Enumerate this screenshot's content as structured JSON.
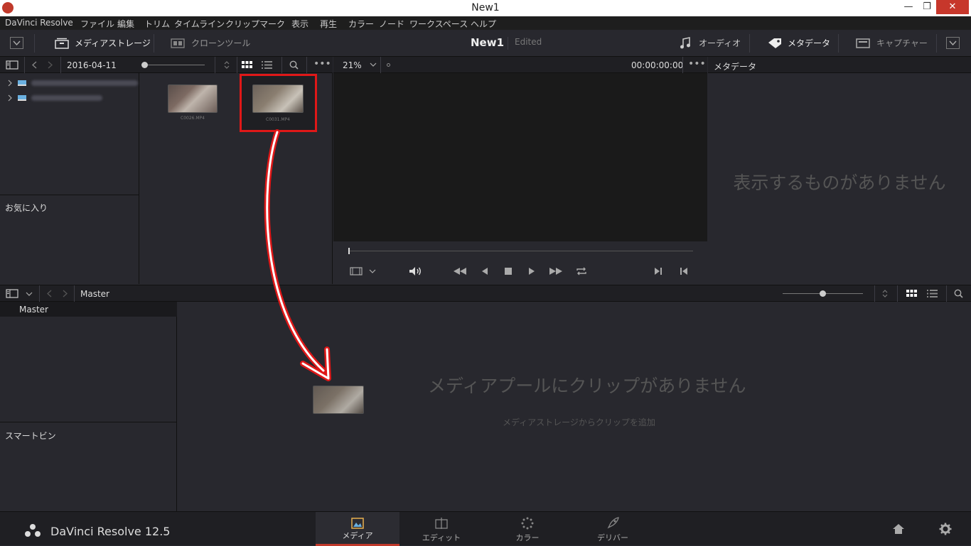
{
  "window": {
    "title": "New1",
    "minimize": "—",
    "restore": "❐",
    "close": "✕"
  },
  "menu": [
    "DaVinci Resolve",
    "ファイル",
    "編集",
    "トリム",
    "タイムライン",
    "クリップ",
    "マーク",
    "表示",
    "再生",
    "カラー",
    "ノード",
    "ワークスペース",
    "ヘルプ"
  ],
  "toolbar": {
    "media_storage": "メディアストレージ",
    "clone_tool": "クローンツール",
    "project_name": "New1",
    "project_status": "Edited",
    "audio": "オーディオ",
    "metadata": "メタデータ",
    "capture": "キャプチャー"
  },
  "media_storage": {
    "date_folder": "2016-04-11",
    "favorites": "お気に入り",
    "clips": [
      {
        "name": "C0026.MP4"
      },
      {
        "name": "C0031.MP4"
      }
    ]
  },
  "viewer": {
    "zoom": "21%",
    "timecode": "00:00:00:00"
  },
  "metadata_panel": {
    "header": "メタデータ",
    "empty": "表示するものがありません"
  },
  "media_pool": {
    "bin": "Master",
    "tree_master": "Master",
    "smart_bins": "スマートビン",
    "empty_title": "メディアプールにクリップがありません",
    "empty_sub": "メディアストレージからクリップを追加"
  },
  "bottom": {
    "app_name": "DaVinci Resolve 12.5",
    "tabs": [
      "メディア",
      "エディット",
      "カラー",
      "デリバー"
    ]
  },
  "colors": {
    "highlight_box": "#e01818",
    "arrow": "#e01818",
    "active_tab": "#c0392b"
  }
}
